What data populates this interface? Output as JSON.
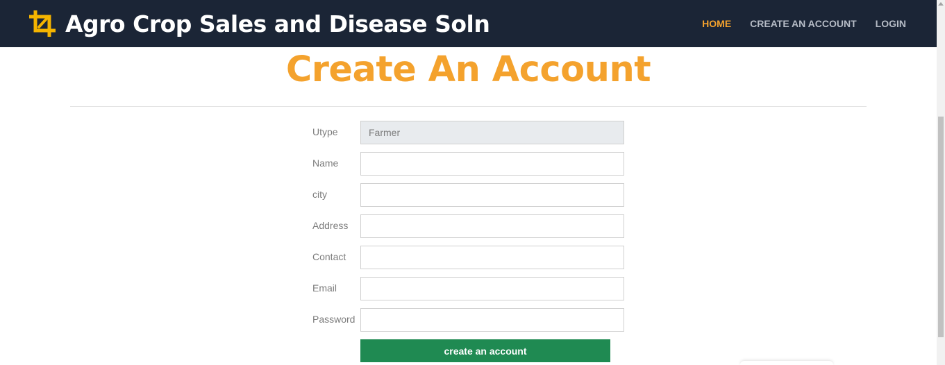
{
  "header": {
    "brand_title": "Agro Crop Sales and Disease Soln",
    "brand_icon": "crop-icon",
    "nav": {
      "home": "HOME",
      "create_account": "CREATE AN ACCOUNT",
      "login": "LOGIN"
    }
  },
  "main": {
    "heading": "Create An Account",
    "form": {
      "utype": {
        "label": "Utype",
        "value": "Farmer"
      },
      "name": {
        "label": "Name",
        "value": ""
      },
      "city": {
        "label": "city",
        "value": ""
      },
      "address": {
        "label": "Address",
        "value": ""
      },
      "contact": {
        "label": "Contact",
        "value": ""
      },
      "email": {
        "label": "Email",
        "value": ""
      },
      "password": {
        "label": "Password",
        "value": ""
      },
      "submit_label": "create an account"
    }
  },
  "colors": {
    "navbar_bg": "#1b2536",
    "accent": "#f4a22d",
    "nav_link": "#b6bcc6",
    "button_bg": "#1f8a52",
    "readonly_bg": "#e8ebee"
  }
}
